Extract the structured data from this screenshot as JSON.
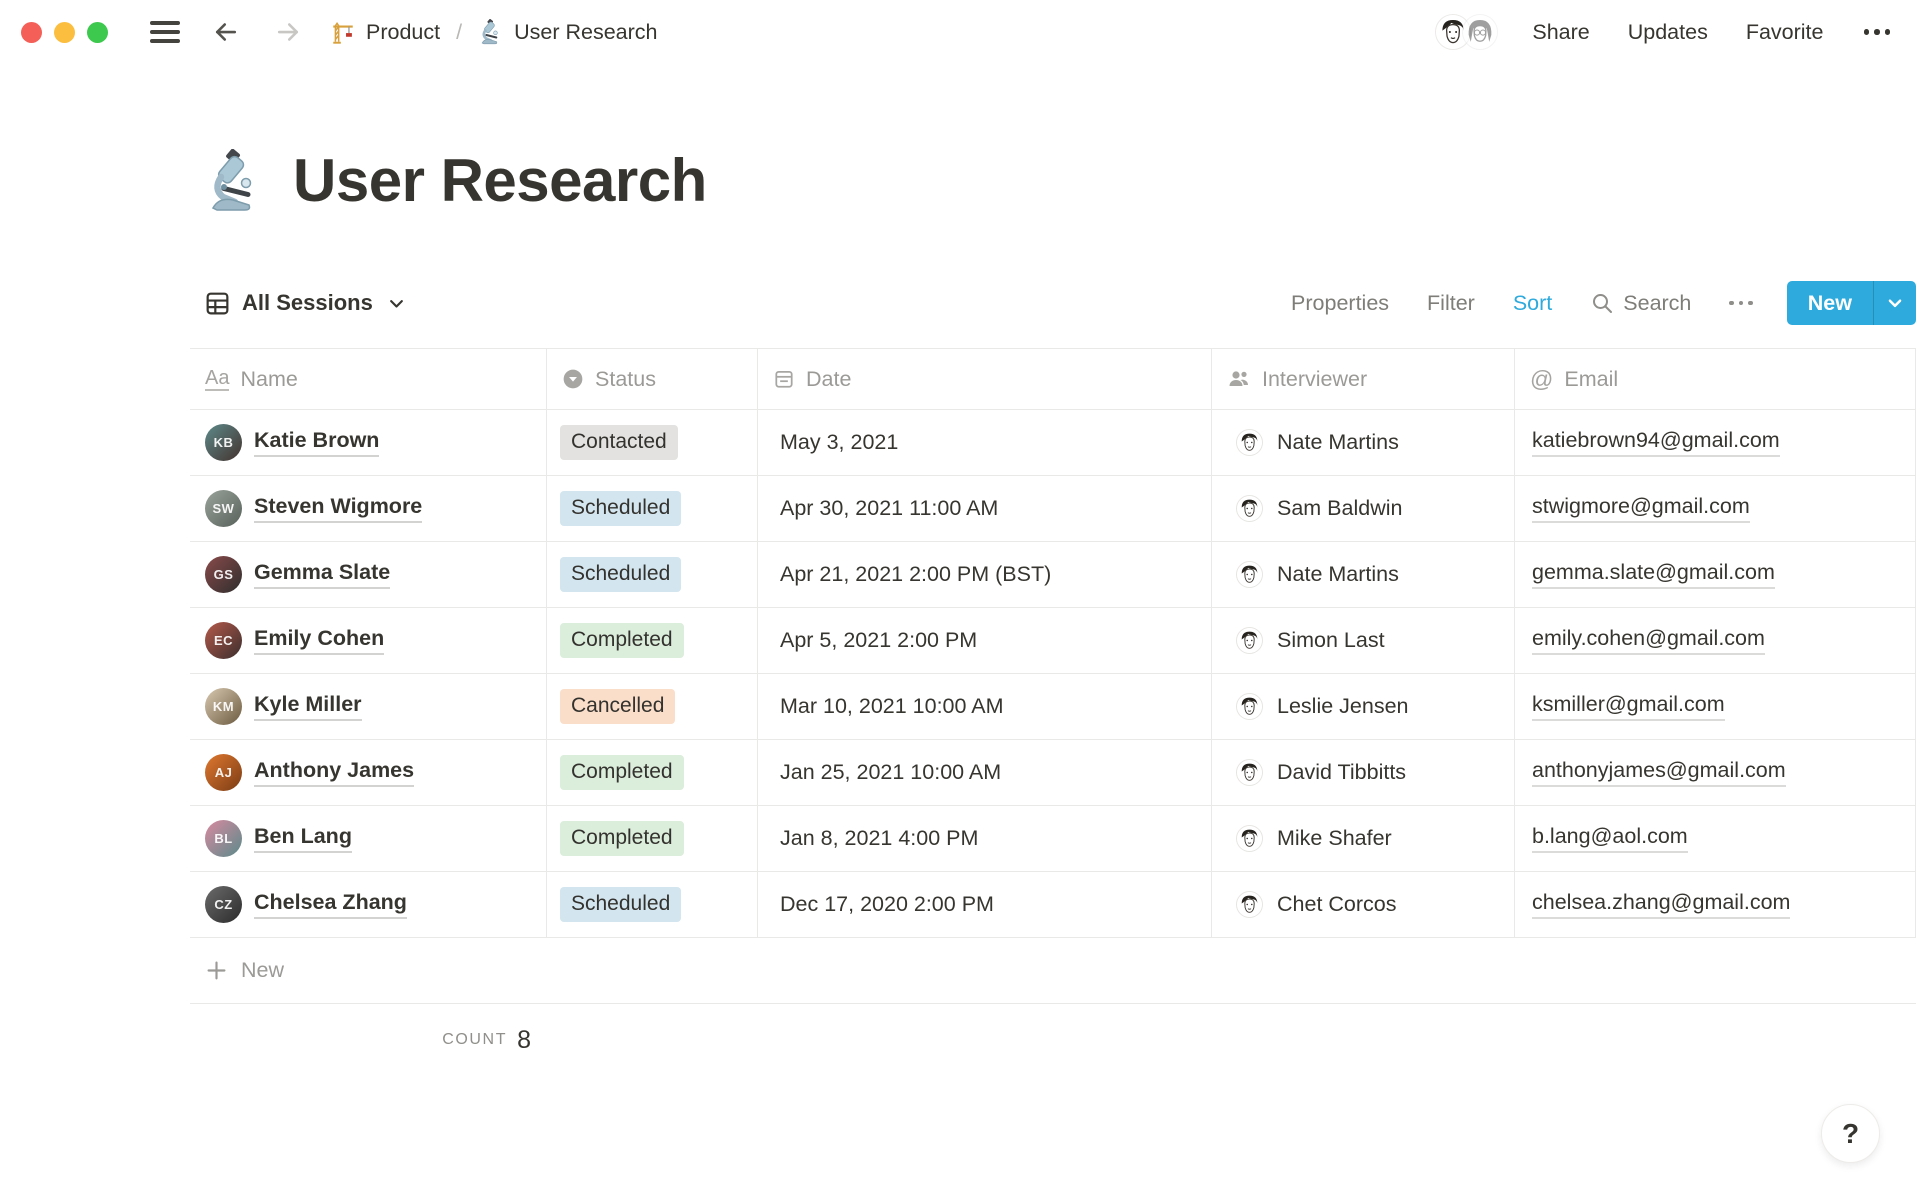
{
  "topbar": {
    "breadcrumb": {
      "parent": "Product",
      "separator": "/",
      "current": "User Research"
    },
    "share_label": "Share",
    "updates_label": "Updates",
    "favorite_label": "Favorite"
  },
  "page": {
    "title": "User Research",
    "icon": "microscope-emoji"
  },
  "view_bar": {
    "view_name": "All Sessions",
    "properties_label": "Properties",
    "filter_label": "Filter",
    "sort_label": "Sort",
    "search_label": "Search",
    "new_label": "New"
  },
  "colors": {
    "accent_blue": "#2EAADC",
    "badge_gray": "#E3E2E0",
    "badge_blue": "#D3E5EF",
    "badge_green": "#DBEDDB",
    "badge_orange": "#FADEC9"
  },
  "table": {
    "columns": [
      {
        "label": "Name",
        "icon": "text-property-icon"
      },
      {
        "label": "Status",
        "icon": "select-property-icon"
      },
      {
        "label": "Date",
        "icon": "calendar-property-icon"
      },
      {
        "label": "Interviewer",
        "icon": "person-property-icon"
      },
      {
        "label": "Email",
        "icon": "at-property-icon"
      }
    ],
    "name_icon_text": "Aa",
    "email_icon_text": "@",
    "rows": [
      {
        "name": "Katie Brown",
        "status": "Contacted",
        "status_color": "gray",
        "date": "May 3, 2021",
        "interviewer": "Nate Martins",
        "email": "katiebrown94@gmail.com",
        "avatar_colors": [
          "#5d8a8a",
          "#44322e"
        ]
      },
      {
        "name": "Steven Wigmore",
        "status": "Scheduled",
        "status_color": "blue",
        "date": "Apr 30, 2021 11:00 AM",
        "interviewer": "Sam Baldwin",
        "email": "stwigmore@gmail.com",
        "avatar_colors": [
          "#9aa39b",
          "#57605a"
        ]
      },
      {
        "name": "Gemma Slate",
        "status": "Scheduled",
        "status_color": "blue",
        "date": "Apr 21, 2021 2:00 PM (BST)",
        "interviewer": "Nate Martins",
        "email": "gemma.slate@gmail.com",
        "avatar_colors": [
          "#8a4a4a",
          "#2e2e2e"
        ]
      },
      {
        "name": "Emily Cohen",
        "status": "Completed",
        "status_color": "green",
        "date": "Apr 5, 2021 2:00 PM",
        "interviewer": "Simon Last",
        "email": "emily.cohen@gmail.com",
        "avatar_colors": [
          "#b55a4a",
          "#3a2e2e"
        ]
      },
      {
        "name": "Kyle Miller",
        "status": "Cancelled",
        "status_color": "orange",
        "date": "Mar 10, 2021 10:00 AM",
        "interviewer": "Leslie Jensen",
        "email": "ksmiller@gmail.com",
        "avatar_colors": [
          "#d9c9b2",
          "#6b5a3e"
        ]
      },
      {
        "name": "Anthony James",
        "status": "Completed",
        "status_color": "green",
        "date": "Jan 25, 2021 10:00 AM",
        "interviewer": "David Tibbitts",
        "email": "anthonyjames@gmail.com",
        "avatar_colors": [
          "#e07830",
          "#7a3c14"
        ]
      },
      {
        "name": "Ben Lang",
        "status": "Completed",
        "status_color": "green",
        "date": "Jan 8, 2021 4:00 PM",
        "interviewer": "Mike Shafer",
        "email": "b.lang@aol.com",
        "avatar_colors": [
          "#d98aa0",
          "#5a8a8a"
        ]
      },
      {
        "name": "Chelsea Zhang",
        "status": "Scheduled",
        "status_color": "blue",
        "date": "Dec 17, 2020 2:00 PM",
        "interviewer": "Chet Corcos",
        "email": "chelsea.zhang@gmail.com",
        "avatar_colors": [
          "#6b6b6b",
          "#2b2b2b"
        ]
      }
    ],
    "new_row_label": "New",
    "count_label": "COUNT",
    "count_value": "8"
  },
  "help_button": {
    "label": "?"
  }
}
